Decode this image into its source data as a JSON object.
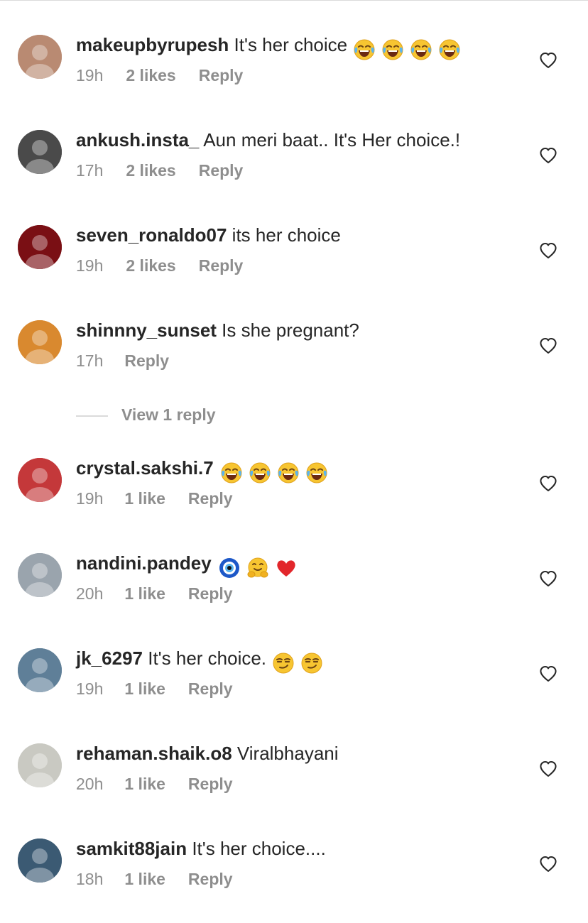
{
  "comments": [
    {
      "username": "makeupbyrupesh",
      "text": "It's her choice",
      "emojis": [
        "joy",
        "joy",
        "joy",
        "joy"
      ],
      "time": "19h",
      "likes": "2 likes",
      "reply": "Reply",
      "avatar_color": "#b98a72"
    },
    {
      "username": "ankush.insta_",
      "text": "Aun meri baat.. It's Her choice.!",
      "emojis": [],
      "time": "17h",
      "likes": "2 likes",
      "reply": "Reply",
      "avatar_color": "#4a4a4a"
    },
    {
      "username": "seven_ronaldo07",
      "text": "its her choice",
      "emojis": [],
      "time": "19h",
      "likes": "2 likes",
      "reply": "Reply",
      "avatar_color": "#7a0f14"
    },
    {
      "username": "shinnny_sunset",
      "text": "Is she pregnant?",
      "emojis": [],
      "time": "17h",
      "likes": "",
      "reply": "Reply",
      "avatar_color": "#d9892f"
    },
    {
      "username": "crystal.sakshi.7",
      "text": "",
      "emojis": [
        "joy",
        "joy",
        "joy",
        "joy"
      ],
      "time": "19h",
      "likes": "1 like",
      "reply": "Reply",
      "avatar_color": "#c4383a"
    },
    {
      "username": "nandini.pandey",
      "text": "",
      "emojis": [
        "nazar",
        "hug",
        "heart"
      ],
      "time": "20h",
      "likes": "1 like",
      "reply": "Reply",
      "avatar_color": "#9aa4ad"
    },
    {
      "username": "jk_6297",
      "text": "It's her choice.",
      "emojis": [
        "smirk",
        "smirk"
      ],
      "time": "19h",
      "likes": "1 like",
      "reply": "Reply",
      "avatar_color": "#5f7f98"
    },
    {
      "username": "rehaman.shaik.o8",
      "text": "Viralbhayani",
      "emojis": [],
      "time": "20h",
      "likes": "1 like",
      "reply": "Reply",
      "avatar_color": "#c9c9c2"
    },
    {
      "username": "samkit88jain",
      "text": "It's her choice....",
      "emojis": [],
      "time": "18h",
      "likes": "1 like",
      "reply": "Reply",
      "avatar_color": "#3b5a73"
    }
  ],
  "view_replies": {
    "label": "View 1 reply"
  },
  "colors": {
    "primary_text": "#262626",
    "secondary_text": "#8e8e8e",
    "divider": "#dbdbdb"
  },
  "icons": {
    "like": "heart-outline-icon"
  }
}
